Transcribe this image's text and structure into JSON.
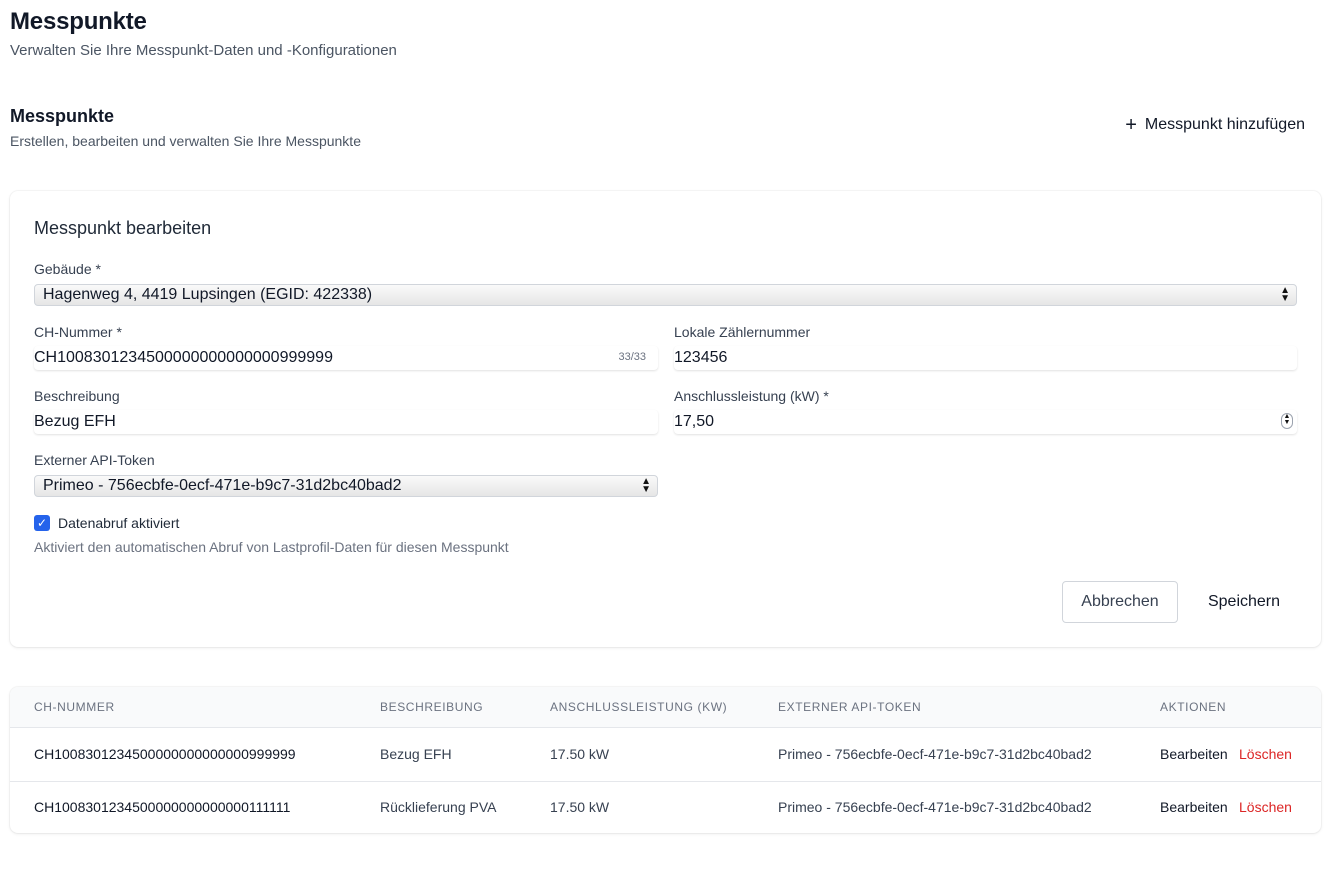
{
  "header": {
    "title": "Messpunkte",
    "subtitle": "Verwalten Sie Ihre Messpunkt-Daten und -Konfigurationen"
  },
  "section": {
    "title": "Messpunkte",
    "subtitle": "Erstellen, bearbeiten und verwalten Sie Ihre Messpunkte",
    "add_label": "Messpunkt hinzufügen"
  },
  "form": {
    "title": "Messpunkt bearbeiten",
    "building_label": "Gebäude *",
    "building_value": "Hagenweg 4, 4419 Lupsingen (EGID: 422338)",
    "ch_label": "CH-Nummer *",
    "ch_value": "CH1008301234500000000000000999999",
    "ch_counter": "33/33",
    "local_label": "Lokale Zählernummer",
    "local_value": "123456",
    "desc_label": "Beschreibung",
    "desc_value": "Bezug EFH",
    "power_label": "Anschlussleistung (kW) *",
    "power_value": "17,50",
    "token_label": "Externer API-Token",
    "token_value": "Primeo - 756ecbfe-0ecf-471e-b9c7-31d2bc40bad2",
    "checkbox_label": "Datenabruf aktiviert",
    "checkbox_checked": true,
    "help_text": "Aktiviert den automatischen Abruf von Lastprofil-Daten für diesen Messpunkt",
    "cancel_label": "Abbrechen",
    "save_label": "Speichern"
  },
  "table": {
    "headers": [
      "CH-NUMMER",
      "BESCHREIBUNG",
      "ANSCHLUSSLEISTUNG (KW)",
      "EXTERNER API-TOKEN",
      "AKTIONEN"
    ],
    "rows": [
      {
        "ch": "CH1008301234500000000000000999999",
        "desc": "Bezug EFH",
        "power": "17.50 kW",
        "token": "Primeo - 756ecbfe-0ecf-471e-b9c7-31d2bc40bad2",
        "edit": "Bearbeiten",
        "delete": "Löschen"
      },
      {
        "ch": "CH1008301234500000000000000111111",
        "desc": "Rücklieferung PVA",
        "power": "17.50 kW",
        "token": "Primeo - 756ecbfe-0ecf-471e-b9c7-31d2bc40bad2",
        "edit": "Bearbeiten",
        "delete": "Löschen"
      }
    ]
  },
  "colors": {
    "accent": "#2563eb",
    "danger": "#dc2626"
  }
}
